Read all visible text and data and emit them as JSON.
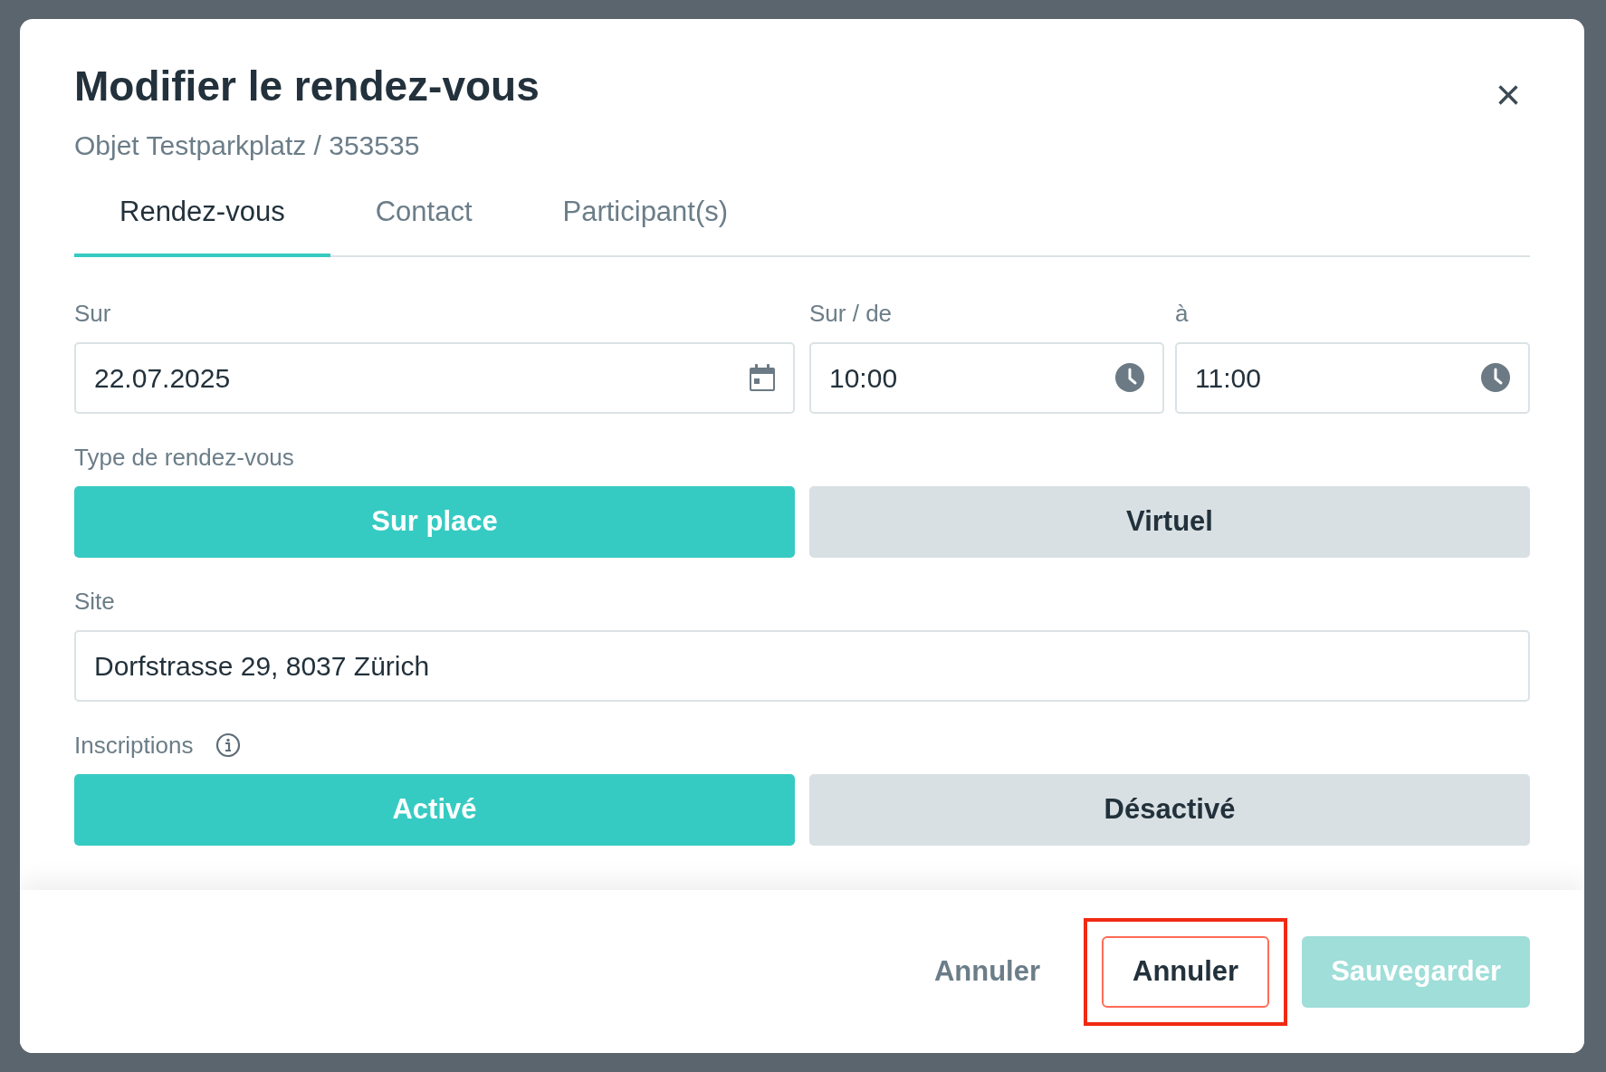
{
  "dialog": {
    "title": "Modifier le rendez-vous",
    "subtitle": "Objet Testparkplatz / 353535",
    "close": "×"
  },
  "tabs": [
    {
      "label": "Rendez-vous",
      "selected": true
    },
    {
      "label": "Contact",
      "selected": false
    },
    {
      "label": "Participant(s)",
      "selected": false
    }
  ],
  "date_fields": [
    {
      "label": "Sur",
      "value": "22.07.2025",
      "kind": "date"
    },
    {
      "label": "Sur / de",
      "value": "10:00",
      "kind": "time"
    },
    {
      "label": "à",
      "value": "11:00",
      "kind": "time"
    }
  ],
  "appointment_type": {
    "label": "Type de rendez-vous",
    "options": [
      {
        "label": "Sur place",
        "selected": true
      },
      {
        "label": "Virtuel",
        "selected": false
      }
    ]
  },
  "site": {
    "label": "Site",
    "value": "Dorfstrasse 29, 8037 Zürich"
  },
  "registrations": {
    "label": "Inscriptions",
    "options": [
      {
        "label": "Activé",
        "selected": true
      },
      {
        "label": "Désactivé",
        "selected": false
      }
    ]
  },
  "footer": {
    "buttons": [
      {
        "label": "Annuler",
        "kind": "text",
        "highlighted": false
      },
      {
        "label": "Annuler",
        "kind": "outline",
        "highlighted": true
      },
      {
        "label": "Sauvegarder",
        "kind": "primary",
        "disabled": true,
        "highlighted": false
      }
    ]
  }
}
